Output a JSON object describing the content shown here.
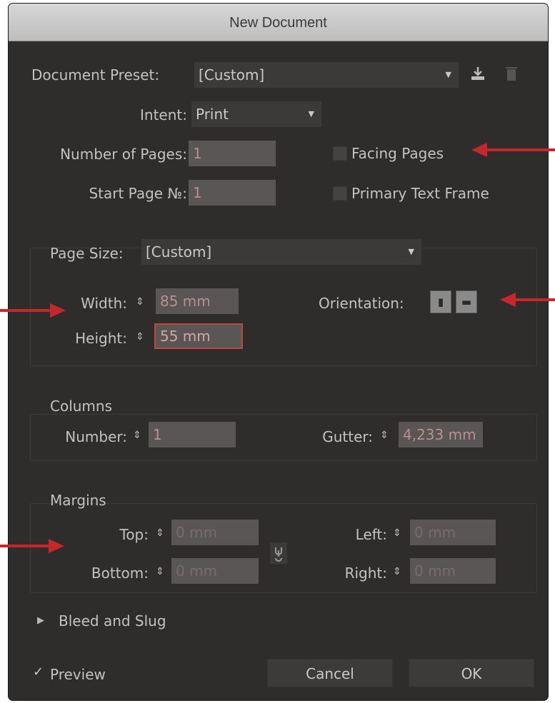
{
  "dialog": {
    "title": "New Document"
  },
  "preset": {
    "label": "Document Preset:",
    "value": "[Custom]"
  },
  "intent": {
    "label": "Intent:",
    "value": "Print"
  },
  "pages": {
    "count_label": "Number of Pages:",
    "count_value": "1",
    "start_label": "Start Page №:",
    "start_value": "1"
  },
  "checkboxes": {
    "facing": "Facing Pages",
    "primary_text": "Primary Text Frame"
  },
  "page_size": {
    "label": "Page Size:",
    "value": "[Custom]",
    "width_label": "Width:",
    "width_value": "85 mm",
    "height_label": "Height:",
    "height_value": "55 mm",
    "orientation_label": "Orientation:"
  },
  "columns": {
    "title": "Columns",
    "number_label": "Number:",
    "number_value": "1",
    "gutter_label": "Gutter:",
    "gutter_value": "4,233 mm"
  },
  "margins": {
    "title": "Margins",
    "top_label": "Top:",
    "top_value": "0 mm",
    "bottom_label": "Bottom:",
    "bottom_value": "0 mm",
    "left_label": "Left:",
    "left_value": "0 mm",
    "right_label": "Right:",
    "right_value": "0 mm"
  },
  "bleed": {
    "label": "Bleed and Slug"
  },
  "footer": {
    "preview_label": "Preview",
    "cancel_label": "Cancel",
    "ok_label": "OK"
  },
  "icons": {
    "dropdown": "chevron-down-icon",
    "save_preset": "save-preset-icon",
    "delete_preset": "trash-icon",
    "stepper": "stepper-icon",
    "portrait": "portrait-orientation-icon",
    "landscape": "landscape-orientation-icon",
    "link": "link-icon",
    "disclosure": "disclosure-triangle-icon",
    "check": "checkmark-icon"
  },
  "colors": {
    "annotation_arrow": "#c8262d",
    "dialog_bg": "#2e2d2c",
    "focus_ring": "#c0463c"
  }
}
